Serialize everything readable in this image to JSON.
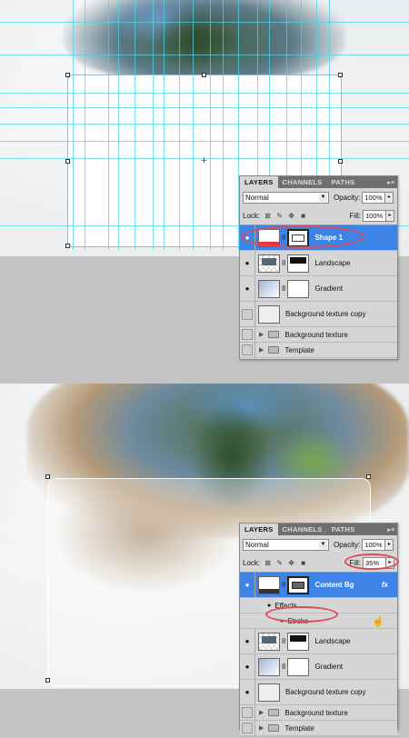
{
  "top_panel": {
    "tabs": [
      "LAYERS",
      "CHANNELS",
      "PATHS"
    ],
    "blend_mode": "Normal",
    "opacity_label": "Opacity:",
    "opacity_value": "100%",
    "lock_label": "Lock:",
    "fill_label": "Fill:",
    "fill_value": "100%",
    "layers": [
      {
        "name": "Shape 1",
        "selected": true
      },
      {
        "name": "Landscape"
      },
      {
        "name": "Gradient"
      },
      {
        "name": "Background texture copy"
      },
      {
        "name": "Background texture"
      },
      {
        "name": "Template"
      }
    ]
  },
  "bottom_panel": {
    "tabs": [
      "LAYERS",
      "CHANNELS",
      "PATHS"
    ],
    "blend_mode": "Normal",
    "opacity_label": "Opacity:",
    "opacity_value": "100%",
    "lock_label": "Lock:",
    "fill_label": "Fill:",
    "fill_value": "35%",
    "fx_badge": "fx",
    "effects_label": "Effects",
    "stroke_label": "Stroke",
    "layers": [
      {
        "name": "Content Bg",
        "selected": true
      },
      {
        "name": "Landscape"
      },
      {
        "name": "Gradient"
      },
      {
        "name": "Background texture copy"
      },
      {
        "name": "Background texture"
      },
      {
        "name": "Template"
      }
    ]
  },
  "colors": {
    "selection": "#3d84e6",
    "guide": "#50d2e6",
    "highlight_ring": "#e04a5a",
    "panel_bg": "#d6d6d6"
  }
}
